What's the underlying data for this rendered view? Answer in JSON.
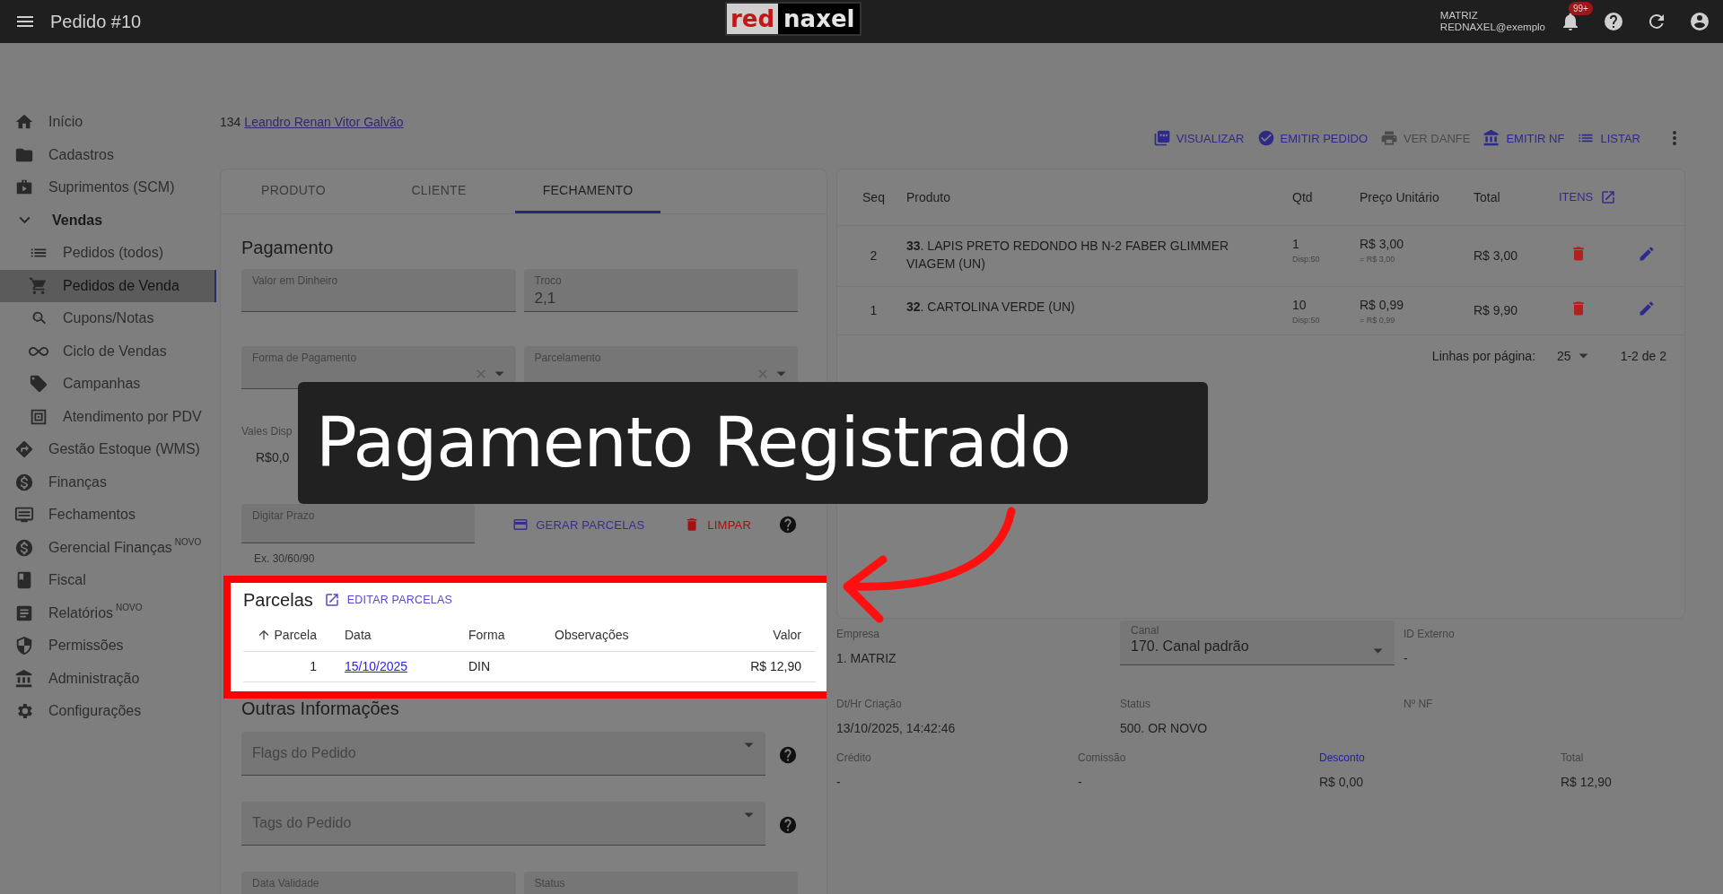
{
  "app_bar": {
    "title": "Pedido #10",
    "logo": [
      "red",
      "naxel"
    ],
    "company": "MATRIZ",
    "user": "REDNAXEL@exemplo",
    "notifications": "99+"
  },
  "sidebar": {
    "items": [
      {
        "label": "Início"
      },
      {
        "label": "Cadastros"
      },
      {
        "label": "Suprimentos (SCM)"
      },
      {
        "label": "Vendas",
        "expanded": true,
        "children": [
          {
            "label": "Pedidos (todos)",
            "selected": false
          },
          {
            "label": "Pedidos de Venda",
            "selected": true
          },
          {
            "label": "Cupons/Notas",
            "selected": false
          },
          {
            "label": "Ciclo de Vendas",
            "selected": false
          },
          {
            "label": "Campanhas",
            "selected": false
          },
          {
            "label": "Atendimento por PDV",
            "selected": false
          }
        ]
      },
      {
        "label": "Gestão Estoque (WMS)"
      },
      {
        "label": "Finanças"
      },
      {
        "label": "Fechamentos"
      },
      {
        "label": "Gerencial Finanças",
        "badge": "NOVO"
      },
      {
        "label": "Fiscal"
      },
      {
        "label": "Relatórios",
        "badge": "NOVO"
      },
      {
        "label": "Permissões"
      },
      {
        "label": "Administração"
      },
      {
        "label": "Configurações"
      }
    ]
  },
  "customer": {
    "code": "134",
    "name": "Leandro Renan Vitor Galvão"
  },
  "actions": [
    {
      "label": "VISUALIZAR",
      "disabled": false
    },
    {
      "label": "EMITIR PEDIDO",
      "disabled": false
    },
    {
      "label": "VER DANFE",
      "disabled": true
    },
    {
      "label": "EMITIR NF",
      "disabled": false
    },
    {
      "label": "LISTAR",
      "disabled": false
    }
  ],
  "tabs": [
    {
      "label": "PRODUTO",
      "selected": false
    },
    {
      "label": "CLIENTE",
      "selected": false
    },
    {
      "label": "FECHAMENTO",
      "selected": true
    }
  ],
  "payment": {
    "title": "Pagamento",
    "fields": [
      {
        "kind": "text",
        "label": "Valor em Dinheiro"
      },
      {
        "kind": "text",
        "label": "Troco",
        "value": "2,1"
      },
      {
        "kind": "select",
        "label": "Forma de Pagamento"
      },
      {
        "kind": "select",
        "label": "Parcelamento"
      }
    ],
    "vouchers": {
      "label": "Vales Disp",
      "value": "R$0,0"
    },
    "term": {
      "label": "Digitar Prazo",
      "hint": "Ex. 30/60/90"
    },
    "generate": "GERAR PARCELAS",
    "clear": "LIMPAR"
  },
  "installments": {
    "title": "Parcelas",
    "edit": "EDITAR PARCELAS",
    "columns": [
      {
        "label": "Parcela",
        "sorted": true
      },
      {
        "label": "Data",
        "sorted": false
      },
      {
        "label": "Forma",
        "sorted": false
      },
      {
        "label": "Observações",
        "sorted": false
      },
      {
        "label": "Valor",
        "sorted": false
      }
    ],
    "rows": [
      {
        "number": "1",
        "date": "15/10/2025",
        "method": "DIN",
        "notes": "",
        "value": "R$ 12,90"
      }
    ]
  },
  "other_info": {
    "title": "Outras Informações",
    "selects": [
      "Flags do Pedido",
      "Tags do Pedido"
    ],
    "fields": [
      "Data Validade",
      "Status"
    ]
  },
  "items": {
    "columns": [
      "Seq",
      "Produto",
      "Qtd",
      "Preço Unitário",
      "Total"
    ],
    "link": "ITENS",
    "rows": [
      {
        "seq": "2",
        "product": "**33**. LAPIS PRETO REDONDO HB N-2 FABER GLIMMER VIAGEM (UN)",
        "qty": "1",
        "available": "Disp:50",
        "price": "R$ 3,00",
        "price_note": "= R$ 3,00",
        "total": "R$ 3,00"
      },
      {
        "seq": "1",
        "product": "**32**. CARTOLINA VERDE (UN)",
        "qty": "10",
        "available": "Disp:50",
        "price": "R$ 0,99",
        "price_note": "= R$ 0,99",
        "total": "R$ 9,90"
      }
    ],
    "pagination": {
      "label": "Linhas por página:",
      "per_page": "25",
      "range": "1-2 de 2"
    }
  },
  "summary": {
    "rows": [
      [
        {
          "label": "Empresa",
          "value": "1. MATRIZ"
        },
        {
          "kind": "select",
          "label": "Canal",
          "value": "170. Canal padrão"
        },
        {
          "label": "ID Externo",
          "value": "-"
        }
      ],
      [
        {
          "label": "Dt/Hr Criação",
          "value": "13/10/2025, 14:42:46"
        },
        {
          "label": "Status",
          "value": "500. OR NOVO"
        },
        {
          "label": "Nº NF"
        }
      ],
      [
        {
          "label": "Crédito",
          "value": "-"
        },
        {
          "label": "Comissão",
          "value": "-"
        },
        {
          "label": "Desconto",
          "value": "R$ 0,00",
          "link": true
        },
        {
          "label": "Total",
          "value": "R$ 12,90"
        }
      ]
    ]
  },
  "annotation": {
    "caption": "Pagamento Registrado"
  }
}
